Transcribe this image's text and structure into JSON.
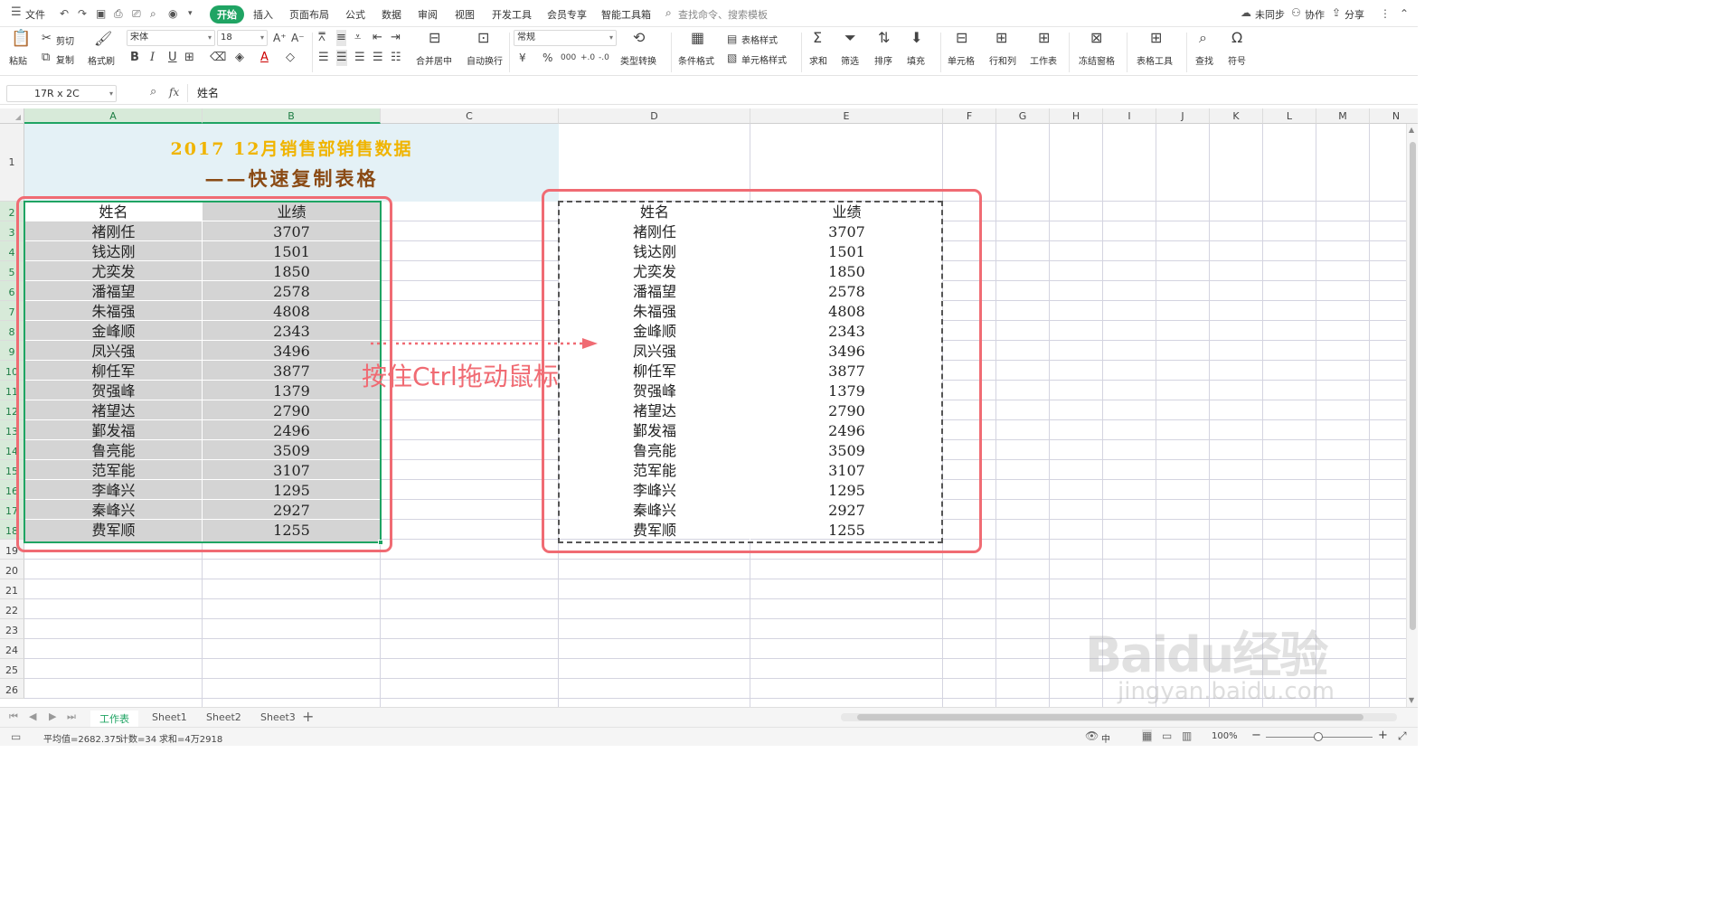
{
  "menu": {
    "file": "文件",
    "tabs": [
      "开始",
      "插入",
      "页面布局",
      "公式",
      "数据",
      "审阅",
      "视图",
      "开发工具",
      "会员专享",
      "智能工具箱"
    ],
    "search": "查找命令、搜索模板",
    "right": [
      "未同步",
      "协作",
      "分享"
    ]
  },
  "ribbon": {
    "paste": "粘贴",
    "cut": "剪切",
    "copy": "复制",
    "format_painter": "格式刷",
    "font_name": "宋体",
    "font_size": "18",
    "merge_center": "合并居中",
    "wrap": "自动换行",
    "number_format": "常规",
    "type_convert": "类型转换",
    "cond_format": "条件格式",
    "table_style": "表格样式",
    "cell_style": "单元格样式",
    "sum": "求和",
    "filter": "筛选",
    "sort": "排序",
    "fill": "填充",
    "cell": "单元格",
    "row_col": "行和列",
    "worksheet": "工作表",
    "freeze": "冻结窗格",
    "table_tools": "表格工具",
    "find": "查找",
    "symbol": "符号"
  },
  "formula_bar": {
    "name_box": "17R x 2C",
    "fx": "fx",
    "content": "姓名"
  },
  "columns": [
    "A",
    "B",
    "C",
    "D",
    "E",
    "F",
    "G",
    "H",
    "I",
    "J",
    "K",
    "L",
    "M",
    "N"
  ],
  "rows": [
    "1",
    "2",
    "3",
    "4",
    "5",
    "6",
    "7",
    "8",
    "9",
    "10",
    "11",
    "12",
    "13",
    "14",
    "15",
    "16",
    "17",
    "18",
    "19",
    "20",
    "21",
    "22",
    "23",
    "24",
    "25",
    "26"
  ],
  "title": {
    "line1": "2017 12月销售部销售数据",
    "line2": "——快速复制表格"
  },
  "table": {
    "headers": [
      "姓名",
      "业绩"
    ],
    "rows": [
      [
        "褚刚任",
        "3707"
      ],
      [
        "钱达刚",
        "1501"
      ],
      [
        "尤奕发",
        "1850"
      ],
      [
        "潘福望",
        "2578"
      ],
      [
        "朱福强",
        "4808"
      ],
      [
        "金峰顺",
        "2343"
      ],
      [
        "凤兴强",
        "3496"
      ],
      [
        "柳任军",
        "3877"
      ],
      [
        "贺强峰",
        "1379"
      ],
      [
        "褚望达",
        "2790"
      ],
      [
        "鄞发福",
        "2496"
      ],
      [
        "鲁亮能",
        "3509"
      ],
      [
        "范军能",
        "3107"
      ],
      [
        "李峰兴",
        "1295"
      ],
      [
        "秦峰兴",
        "2927"
      ],
      [
        "费军顺",
        "1255"
      ]
    ]
  },
  "annotation": "按住Ctrl拖动鼠标",
  "sheet_tabs": [
    "工作表",
    "Sheet1",
    "Sheet2",
    "Sheet3"
  ],
  "status": {
    "avg": "平均值=2682.375",
    "count": "计数=34",
    "sum": "求和=4万2918",
    "lang": "中",
    "zoom": "100%"
  },
  "watermark": {
    "logo": "Baidu经验",
    "url": "jingyan.baidu.com"
  },
  "colors": {
    "accent": "#1fa463",
    "highlight_border": "#f06b73",
    "title_gold": "#f0b400",
    "title_brown": "#8a4a14",
    "title_bg": "#e4f1f6",
    "selection_fill": "#d4d4d4"
  }
}
